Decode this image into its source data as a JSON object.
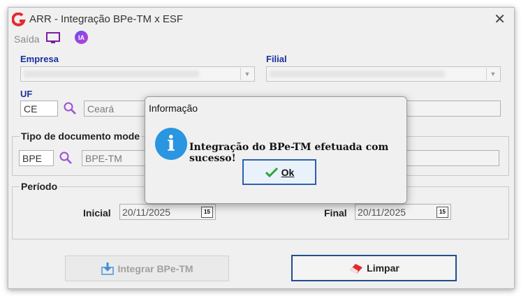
{
  "window": {
    "title": "ARR - Integração BPe-TM x ESF",
    "close_glyph": "✕"
  },
  "toolbar": {
    "exit_label": "Saída",
    "ia_label": "IA",
    "monitor_icon": "monitor-icon"
  },
  "empresa": {
    "label": "Empresa"
  },
  "filial": {
    "label": "Filial"
  },
  "uf": {
    "label": "UF",
    "code": "CE",
    "name": "Ceará"
  },
  "tipo_doc": {
    "label": "Tipo de documento mode",
    "code": "BPE",
    "name": "BPE-TM"
  },
  "periodo": {
    "label": "Período",
    "inicial_label": "Inicial",
    "inicial_value": "20/11/2025",
    "final_label": "Final",
    "final_value": "20/11/2025",
    "calendar_glyph": "15"
  },
  "buttons": {
    "integrar": "Integrar BPe-TM",
    "limpar": "Limpar"
  },
  "dialog": {
    "title": "Informação",
    "icon_glyph": "i",
    "message": "Integração do BPe-TM efetuada com sucesso!",
    "ok": "Ok"
  },
  "colors": {
    "accent": "#2f5fad",
    "info_blue": "#2a95e0",
    "label_blue": "#1a2f9b",
    "limpar_red": "#e02a2a"
  }
}
